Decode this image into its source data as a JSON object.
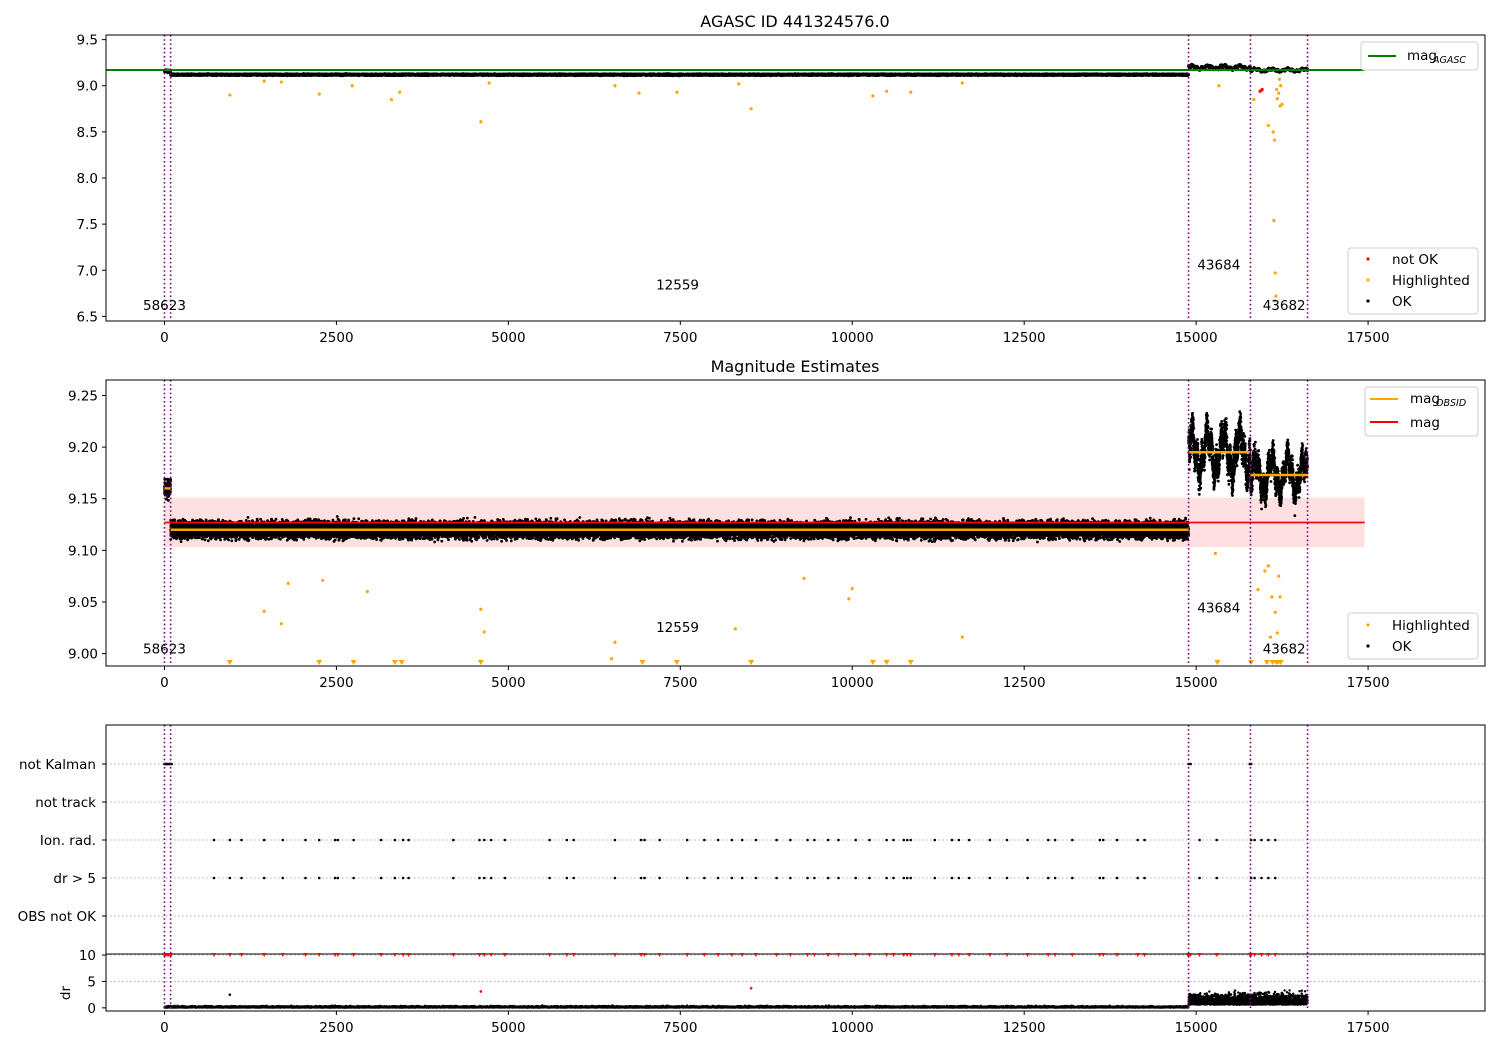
{
  "chart_data": [
    {
      "type": "scatter",
      "title": "AGASC ID 441324576.0",
      "xlim": [
        -850,
        19200
      ],
      "ylim": [
        6.45,
        9.55
      ],
      "x_ticks": [
        0,
        2500,
        5000,
        7500,
        10000,
        12500,
        15000,
        17500
      ],
      "x_tick_labels": [
        "0",
        "2500",
        "5000",
        "7500",
        "10000",
        "12500",
        "15000",
        "17500"
      ],
      "y_ticks": [
        6.5,
        7.0,
        7.5,
        8.0,
        8.5,
        9.0,
        9.5
      ],
      "y_tick_labels": [
        "6.5",
        "7.0",
        "7.5",
        "8.0",
        "8.5",
        "9.0",
        "9.5"
      ],
      "obsid_boundaries": [
        0,
        90,
        14890,
        15790,
        16620
      ],
      "obsid_labels": [
        {
          "text": "58623",
          "x": 0,
          "y": 6.57
        },
        {
          "text": "12559",
          "x": 7460,
          "y": 6.79
        },
        {
          "text": "43684",
          "x": 15330,
          "y": 7.01
        },
        {
          "text": "43682",
          "x": 16280,
          "y": 6.57
        }
      ],
      "mag_agasc": 9.17,
      "ok_segments": [
        {
          "x0": 0,
          "x1": 90,
          "mean": 9.16,
          "spread": 0.02
        },
        {
          "x0": 90,
          "x1": 14890,
          "mean": 9.12,
          "spread": 0.012
        },
        {
          "x0": 14890,
          "x1": 15790,
          "mean": 9.2,
          "spread": 0.025
        },
        {
          "x0": 15790,
          "x1": 16620,
          "mean": 9.17,
          "spread": 0.02
        }
      ],
      "highlighted_points": [
        [
          950,
          8.9
        ],
        [
          1450,
          9.05
        ],
        [
          1700,
          9.04
        ],
        [
          2250,
          8.91
        ],
        [
          2730,
          9.0
        ],
        [
          3300,
          8.85
        ],
        [
          3420,
          8.93
        ],
        [
          4600,
          8.61
        ],
        [
          4720,
          9.03
        ],
        [
          6550,
          9.0
        ],
        [
          6900,
          8.92
        ],
        [
          7450,
          8.93
        ],
        [
          8350,
          9.02
        ],
        [
          8530,
          8.75
        ],
        [
          10300,
          8.89
        ],
        [
          10500,
          8.94
        ],
        [
          10850,
          8.93
        ],
        [
          11600,
          9.03
        ],
        [
          15330,
          9.0
        ],
        [
          15840,
          8.85
        ],
        [
          15950,
          8.95
        ],
        [
          16050,
          8.57
        ],
        [
          16120,
          8.5
        ],
        [
          16140,
          8.41
        ],
        [
          16130,
          7.54
        ],
        [
          16150,
          6.97
        ],
        [
          16160,
          6.72
        ],
        [
          16140,
          6.67
        ],
        [
          16200,
          8.92
        ],
        [
          16220,
          8.78
        ],
        [
          16250,
          8.8
        ],
        [
          16180,
          8.86
        ],
        [
          16230,
          9.0
        ],
        [
          16210,
          9.07
        ],
        [
          16170,
          8.96
        ]
      ],
      "not_ok_points": [
        [
          15930,
          8.94
        ],
        [
          15960,
          8.96
        ]
      ],
      "legends": [
        {
          "entries": [
            {
              "label": "mag",
              "sub": "AGASC",
              "color": "#008000",
              "marker": "line"
            }
          ],
          "loc": "upper right"
        },
        {
          "entries": [
            {
              "label": "not OK",
              "color": "#ff0000",
              "marker": "dot"
            },
            {
              "label": "Highlighted",
              "color": "#ffa500",
              "marker": "dot"
            },
            {
              "label": "OK",
              "color": "#000000",
              "marker": "dot"
            }
          ],
          "loc": "lower right"
        }
      ]
    },
    {
      "type": "scatter",
      "title": "Magnitude Estimates",
      "xlim": [
        -850,
        19200
      ],
      "ylim": [
        8.988,
        9.265
      ],
      "x_ticks": [
        0,
        2500,
        5000,
        7500,
        10000,
        12500,
        15000,
        17500
      ],
      "x_tick_labels": [
        "0",
        "2500",
        "5000",
        "7500",
        "10000",
        "12500",
        "15000",
        "17500"
      ],
      "y_ticks": [
        9.0,
        9.05,
        9.1,
        9.15,
        9.2,
        9.25
      ],
      "y_tick_labels": [
        "9.00",
        "9.05",
        "9.10",
        "9.15",
        "9.20",
        "9.25"
      ],
      "obsid_boundaries": [
        0,
        90,
        14890,
        15790,
        16620
      ],
      "obsid_labels": [
        {
          "text": "58623",
          "x": 0,
          "y": 9.0
        },
        {
          "text": "12559",
          "x": 7460,
          "y": 9.021
        },
        {
          "text": "43684",
          "x": 15330,
          "y": 9.04
        },
        {
          "text": "43682",
          "x": 16280,
          "y": 9.0
        }
      ],
      "mag": 9.127,
      "mag_band": [
        9.103,
        9.151
      ],
      "mag_band_xlim": [
        0,
        17450
      ],
      "mag_obsid": [
        {
          "x0": 0,
          "x1": 90,
          "value": 9.16
        },
        {
          "x0": 90,
          "x1": 14890,
          "value": 9.12
        },
        {
          "x0": 14890,
          "x1": 15790,
          "value": 9.195
        },
        {
          "x0": 15790,
          "x1": 16620,
          "value": 9.173
        }
      ],
      "ok_segments": [
        {
          "x0": 0,
          "x1": 90,
          "mean": 9.16,
          "spread": 0.012
        },
        {
          "x0": 90,
          "x1": 14890,
          "mean": 9.12,
          "spread": 0.011
        },
        {
          "x0": 14890,
          "x1": 15790,
          "mean": 9.195,
          "spread": 0.03
        },
        {
          "x0": 15790,
          "x1": 16620,
          "mean": 9.173,
          "spread": 0.025
        }
      ],
      "highlighted_points": [
        [
          1450,
          9.041
        ],
        [
          1700,
          9.029
        ],
        [
          1800,
          9.068
        ],
        [
          2300,
          9.071
        ],
        [
          2950,
          9.06
        ],
        [
          4600,
          9.043
        ],
        [
          4650,
          9.021
        ],
        [
          6550,
          9.011
        ],
        [
          6500,
          8.995
        ],
        [
          8300,
          9.024
        ],
        [
          9300,
          9.073
        ],
        [
          9950,
          9.053
        ],
        [
          10000,
          9.063
        ],
        [
          11600,
          9.016
        ],
        [
          15280,
          9.097
        ],
        [
          15900,
          9.062
        ],
        [
          16000,
          9.08
        ],
        [
          16050,
          9.085
        ],
        [
          16100,
          9.055
        ],
        [
          16150,
          9.04
        ],
        [
          16180,
          9.02
        ],
        [
          16200,
          9.075
        ],
        [
          16220,
          9.055
        ],
        [
          16080,
          9.016
        ]
      ],
      "clipped_markers_x": [
        950,
        2250,
        2750,
        3350,
        3450,
        4600,
        6950,
        7450,
        8530,
        10300,
        10500,
        10850,
        15310,
        15800,
        16030,
        16110,
        16160,
        16190,
        16230
      ],
      "legends": [
        {
          "entries": [
            {
              "label": "mag",
              "sub": "OBSID",
              "color": "#ffa500",
              "marker": "line"
            },
            {
              "label": "mag",
              "color": "#ff0000",
              "marker": "line"
            }
          ],
          "loc": "upper right"
        },
        {
          "entries": [
            {
              "label": "Highlighted",
              "color": "#ffa500",
              "marker": "dot"
            },
            {
              "label": "OK",
              "color": "#000000",
              "marker": "dot"
            }
          ],
          "loc": "lower right"
        }
      ]
    },
    {
      "type": "scatter",
      "xlim": [
        -850,
        19200
      ],
      "x_ticks": [
        0,
        2500,
        5000,
        7500,
        10000,
        12500,
        15000,
        17500
      ],
      "x_tick_labels": [
        "0",
        "2500",
        "5000",
        "7500",
        "10000",
        "12500",
        "15000",
        "17500"
      ],
      "flag_rows": [
        "not Kalman",
        "not track",
        "Ion. rad.",
        "dr > 5",
        "OBS not OK"
      ],
      "obsid_boundaries": [
        0,
        90,
        14890,
        15790,
        16620
      ],
      "flag_events": {
        "not Kalman": [
          0,
          15,
          30,
          45,
          60,
          75,
          90,
          105,
          14890,
          14920,
          15780,
          15800
        ],
        "not track": [],
        "Ion. rad.": [
          720,
          950,
          1120,
          1450,
          1720,
          2050,
          2250,
          2480,
          2520,
          2750,
          3150,
          3350,
          3470,
          3550,
          4200,
          4580,
          4650,
          4750,
          4950,
          5600,
          5850,
          5950,
          6550,
          6930,
          6980,
          7200,
          7600,
          7850,
          8050,
          8250,
          8400,
          8600,
          8900,
          9100,
          9350,
          9450,
          9650,
          9800,
          10050,
          10250,
          10500,
          10600,
          10750,
          10800,
          10850,
          11200,
          11450,
          11550,
          11700,
          12000,
          12250,
          12550,
          12850,
          12950,
          13200,
          13600,
          13650,
          13850,
          14150,
          14250,
          15050,
          15300,
          15800,
          15850,
          15950,
          16050,
          16150
        ]
      },
      "sub_panel": {
        "ylabel": "dr",
        "ylim": [
          -0.6,
          10.2
        ],
        "y_ticks": [
          0,
          5,
          10
        ],
        "y_tick_labels": [
          "0",
          "5",
          "10"
        ],
        "clip_value": 10,
        "outlier_points": [
          [
            950,
            2.5
          ],
          [
            4600,
            3.1
          ],
          [
            8530,
            3.7
          ],
          [
            16050,
            3.0
          ]
        ]
      }
    }
  ]
}
